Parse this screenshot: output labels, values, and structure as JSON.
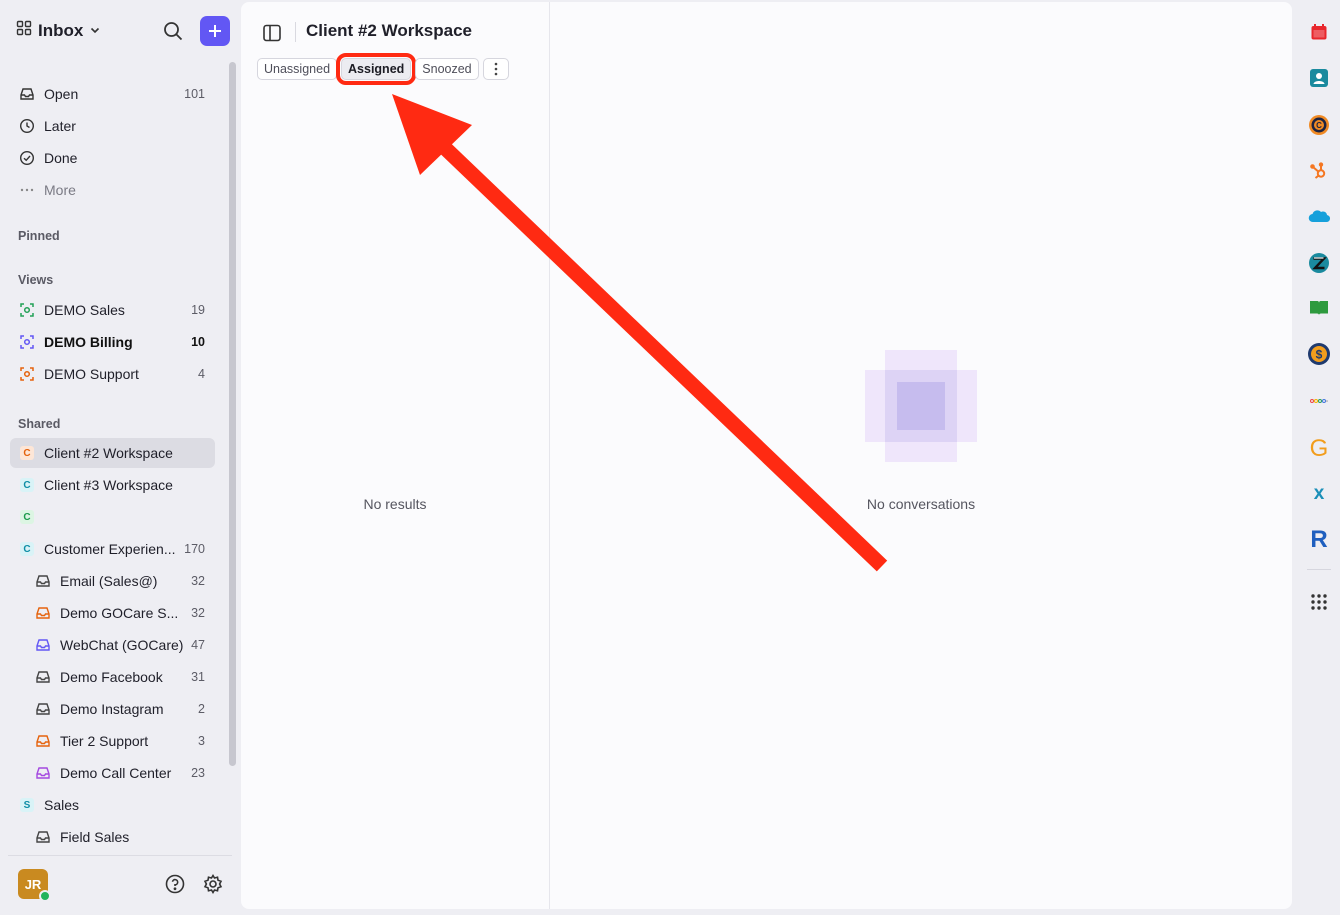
{
  "header": {
    "inbox_label": "Inbox"
  },
  "nav": [
    {
      "label": "Open",
      "count": "101"
    },
    {
      "label": "Later",
      "count": ""
    },
    {
      "label": "Done",
      "count": ""
    },
    {
      "label": "More",
      "count": ""
    }
  ],
  "sections": {
    "pinned": "Pinned",
    "views": "Views",
    "shared": "Shared"
  },
  "views": [
    {
      "label": "DEMO Sales",
      "count": "19"
    },
    {
      "label": "DEMO Billing",
      "count": "10"
    },
    {
      "label": "DEMO Support",
      "count": "4"
    }
  ],
  "shared": [
    {
      "badge": "C",
      "label": "Client #2 Workspace",
      "count": ""
    },
    {
      "badge": "C",
      "label": "Client #3 Workspace",
      "count": ""
    },
    {
      "badge": "C",
      "label": "",
      "count": ""
    },
    {
      "badge": "C",
      "label": "Customer Experien...",
      "count": "170"
    },
    {
      "label": "Email (Sales@)",
      "count": "32"
    },
    {
      "label": "Demo GOCare S...",
      "count": "32"
    },
    {
      "label": "WebChat (GOCare)",
      "count": "47"
    },
    {
      "label": "Demo Facebook",
      "count": "31"
    },
    {
      "label": "Demo Instagram",
      "count": "2"
    },
    {
      "label": "Tier 2 Support",
      "count": "3"
    },
    {
      "label": "Demo Call Center",
      "count": "23"
    },
    {
      "badge": "S",
      "label": "Sales",
      "count": ""
    },
    {
      "label": "Field Sales",
      "count": ""
    }
  ],
  "user": {
    "initials": "JR"
  },
  "workspace": {
    "title": "Client #2 Workspace",
    "tabs": [
      "Unassigned",
      "Assigned",
      "Snoozed"
    ],
    "selected_tab": "Assigned",
    "list_empty": "No results",
    "detail_empty": "No conversations"
  },
  "colors": {
    "accent": "#6257f4",
    "annotation": "#ff2a12"
  },
  "rail_apps": [
    "calendar-icon",
    "contacts-icon",
    "copper-icon",
    "hubspot-icon",
    "salesforce-icon",
    "zendesk-icon",
    "book-icon",
    "billing-icon",
    "monday-icon",
    "g-icon",
    "x-icon",
    "r-icon",
    "apps-grid-icon"
  ]
}
